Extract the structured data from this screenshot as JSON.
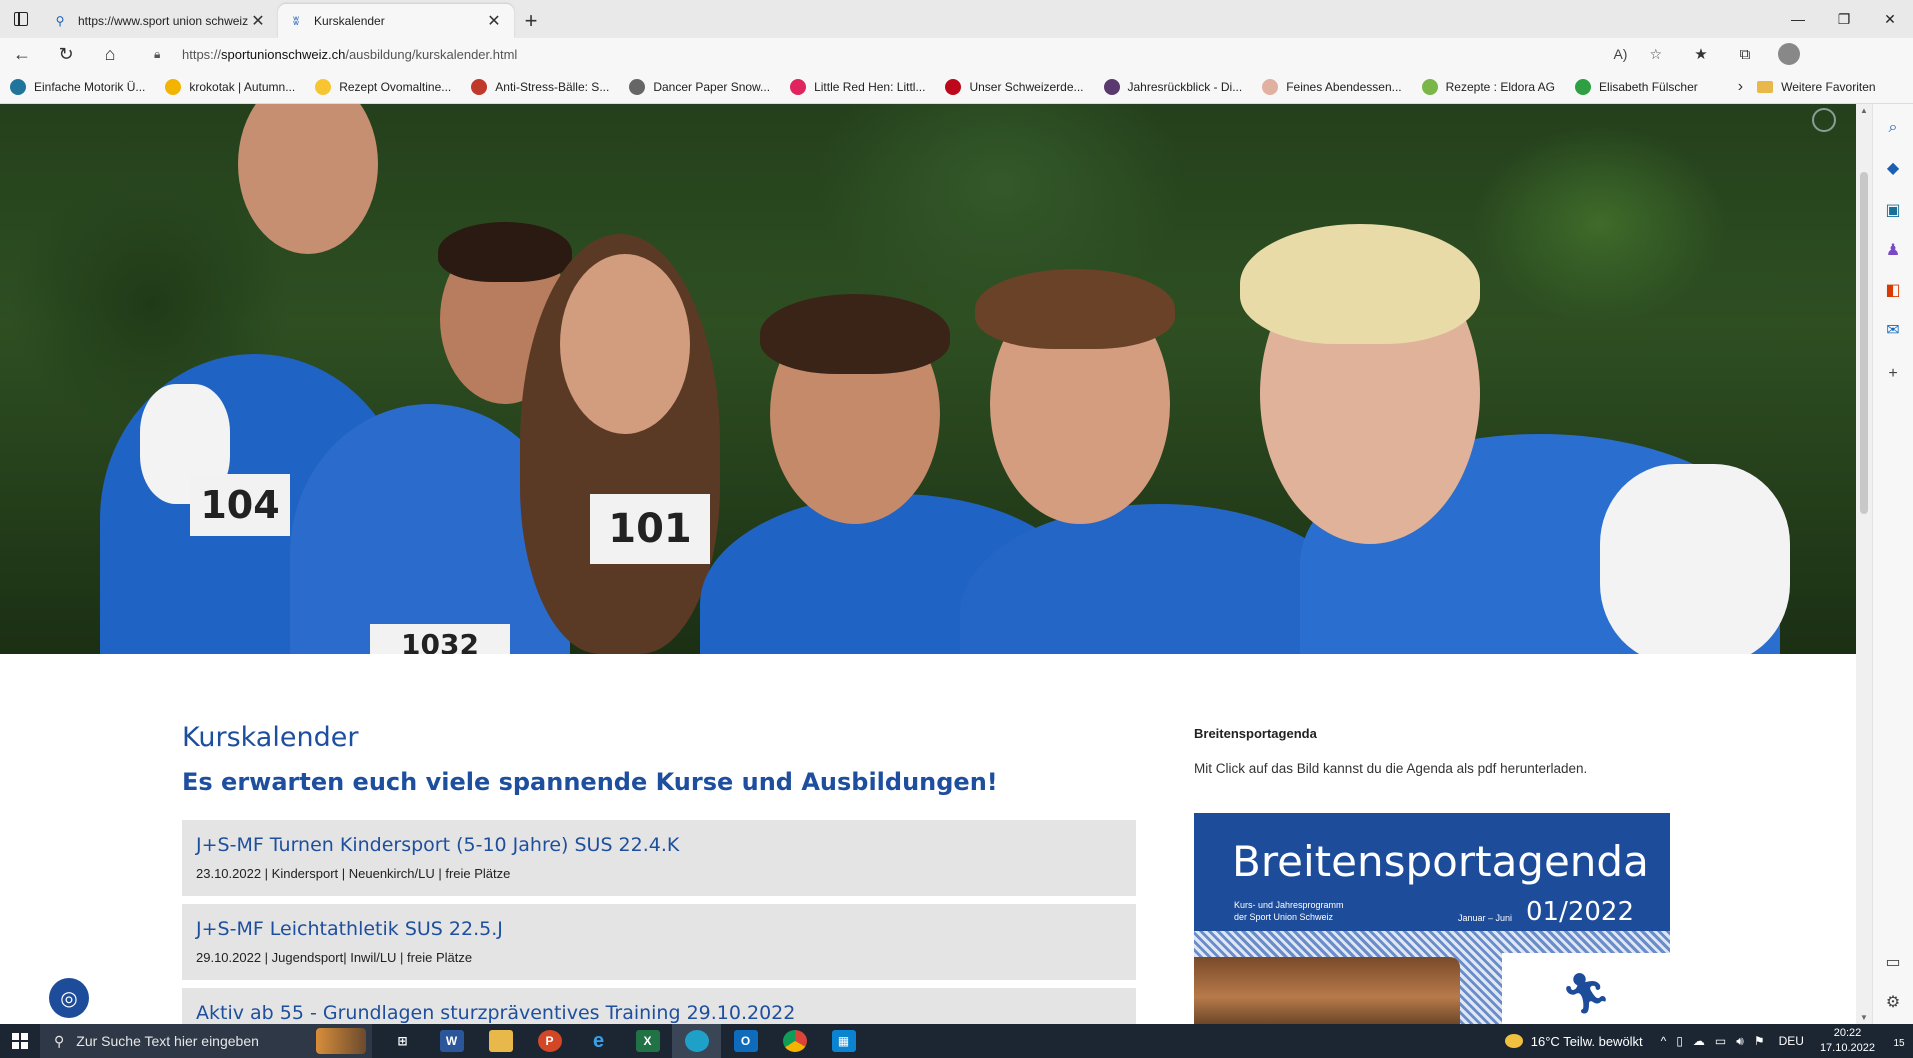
{
  "browser": {
    "tabs": [
      {
        "title": "https://www.sport union schweiz",
        "active": false,
        "favicon": "search-icon"
      },
      {
        "title": "Kurskalender",
        "active": true,
        "favicon": "site-icon"
      }
    ],
    "url_prefix": "https://",
    "url_host": "sportunionschweiz.ch",
    "url_path": "/ausbildung/kurskalender.html",
    "bookmarks": [
      {
        "label": "Einfache Motorik Ü...",
        "icon": "wordpress-icon",
        "color": "#21759b"
      },
      {
        "label": "krokotak | Autumn...",
        "icon": "pencil-icon",
        "color": "#f2b400"
      },
      {
        "label": "Rezept Ovomaltine...",
        "icon": "circle-icon",
        "color": "#f7c531"
      },
      {
        "label": "Anti-Stress-Bälle: S...",
        "icon": "ball-icon",
        "color": "#c0392b"
      },
      {
        "label": "Dancer Paper Snow...",
        "icon": "document-icon",
        "color": "#666666"
      },
      {
        "label": "Little Red Hen: Littl...",
        "icon": "heart-icon",
        "color": "#e0245e"
      },
      {
        "label": "Unser Schweizerde...",
        "icon": "pinterest-icon",
        "color": "#bd081c"
      },
      {
        "label": "Jahresrückblick - Di...",
        "icon": "hat-icon",
        "color": "#5a3a6e"
      },
      {
        "label": "Feines Abendessen...",
        "icon": "dot-icon",
        "color": "#e0b0a0"
      },
      {
        "label": "Rezepte : Eldora AG",
        "icon": "leaf-icon",
        "color": "#7ab648"
      },
      {
        "label": "Elisabeth Fülscher",
        "icon": "ring-icon",
        "color": "#2ea043"
      }
    ],
    "bookmarks_more": "Weitere Favoriten"
  },
  "page": {
    "title": "Kurskalender",
    "subtitle": "Es erwarten euch viele spannende Kurse und Ausbildungen!",
    "courses": [
      {
        "title": "J+S-MF Turnen Kindersport (5-10 Jahre) SUS 22.4.K",
        "meta": "23.10.2022 | Kindersport | Neuenkirch/LU | freie Plätze"
      },
      {
        "title": "J+S-MF Leichtathletik SUS 22.5.J",
        "meta": "29.10.2022 | Jugendsport| Inwil/LU | freie Plätze"
      },
      {
        "title": "Aktiv ab 55 - Grundlagen sturzpräventives Training 29.10.2022",
        "meta": ""
      }
    ],
    "sidebar": {
      "heading": "Breitensportagenda",
      "text": "Mit Click auf das Bild kannst du die Agenda als pdf herunterladen.",
      "agenda_title": "Breitensportagenda",
      "agenda_sub": "Kurs- und Jahresprogramm\nder Sport Union Schweiz",
      "agenda_period": "Januar – Juni",
      "agenda_number": "01/2022"
    },
    "hero_bibs": [
      "104",
      "101",
      "1032"
    ]
  },
  "taskbar": {
    "search_placeholder": "Zur Suche Text hier eingeben",
    "weather": "16°C  Teilw. bewölkt",
    "language": "DEU",
    "time": "20:22",
    "date": "17.10.2022",
    "notifications": "15"
  },
  "colors": {
    "brand_blue": "#1d4f9e",
    "course_bg": "#e4e4e4"
  }
}
